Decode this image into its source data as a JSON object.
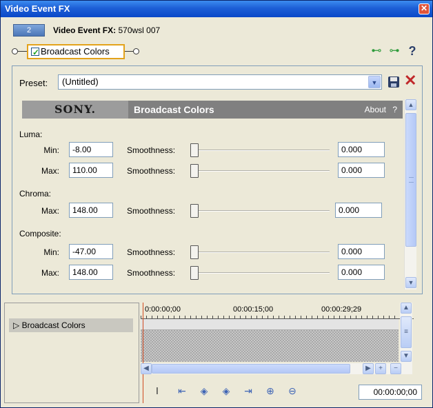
{
  "window": {
    "title": "Video Event FX"
  },
  "header": {
    "badge": "2",
    "label_bold": "Video Event FX:",
    "label_value": "570wsl 007"
  },
  "chain": {
    "fx_name": "Broadcast Colors",
    "enabled": true
  },
  "toolbar": {
    "icons": [
      "plugin-chain-icon",
      "remove-plugin-icon",
      "help-icon"
    ],
    "help_label": "?"
  },
  "preset": {
    "label": "Preset:",
    "value": "(Untitled)"
  },
  "plugin": {
    "brand": "SONY.",
    "name": "Broadcast Colors",
    "about_label": "About",
    "about_q": "?",
    "groups": [
      {
        "label": "Luma:",
        "rows": [
          {
            "label": "Min:",
            "value": "-8.00",
            "smooth_label": "Smoothness:",
            "smooth_value": "0.000"
          },
          {
            "label": "Max:",
            "value": "110.00",
            "smooth_label": "Smoothness:",
            "smooth_value": "0.000"
          }
        ]
      },
      {
        "label": "Chroma:",
        "rows": [
          {
            "label": "Max:",
            "value": "148.00",
            "smooth_label": "Smoothness:",
            "smooth_value": "0.000"
          }
        ]
      },
      {
        "label": "Composite:",
        "rows": [
          {
            "label": "Min:",
            "value": "-47.00",
            "smooth_label": "Smoothness:",
            "smooth_value": "0.000"
          },
          {
            "label": "Max:",
            "value": "148.00",
            "smooth_label": "Smoothness:",
            "smooth_value": "0.000"
          }
        ]
      }
    ]
  },
  "timeline": {
    "track_name": "Broadcast Colors",
    "ruler": [
      "0:00:00;00",
      "00:00:15;00",
      "00:00:29;29"
    ],
    "timecode": "00:00:00;00"
  }
}
